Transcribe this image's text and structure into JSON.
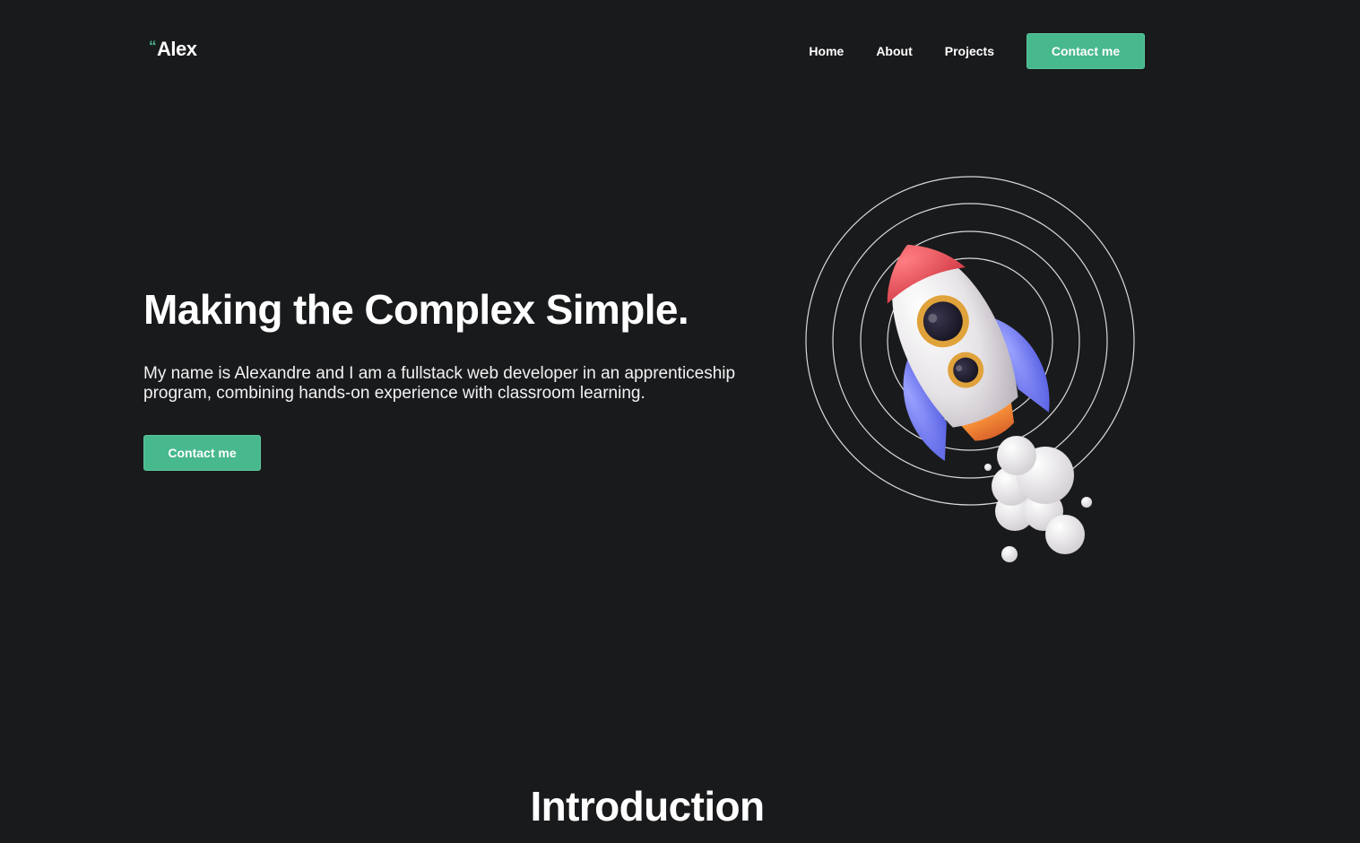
{
  "header": {
    "logo_quote": "“",
    "logo_name": "Alex",
    "nav": [
      "Home",
      "About",
      "Projects"
    ],
    "cta_label": "Contact me"
  },
  "hero": {
    "title": "Making the Complex Simple.",
    "description": "My name is Alexandre and I am a fullstack web developer in an apprenticeship program, combining hands-on experience with classroom learning.",
    "cta_label": "Contact me",
    "illustration": "rocket-illustration"
  },
  "intro": {
    "title": "Introduction"
  },
  "colors": {
    "background": "#191a1c",
    "accent": "#48b88d",
    "text": "#ffffff"
  }
}
